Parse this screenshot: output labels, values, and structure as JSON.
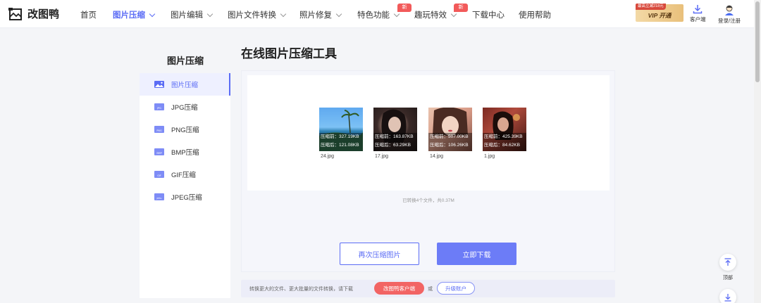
{
  "header": {
    "logo_text": "改图鸭",
    "nav": [
      {
        "label": "首页"
      },
      {
        "label": "图片压缩"
      },
      {
        "label": "图片编辑"
      },
      {
        "label": "图片文件转换"
      },
      {
        "label": "照片修复"
      },
      {
        "label": "特色功能",
        "badge": "新"
      },
      {
        "label": "趣玩特效",
        "badge": "新"
      },
      {
        "label": "下载中心"
      },
      {
        "label": "使用帮助"
      }
    ],
    "vip_tag": "最高立减218元",
    "vip_label": "VIP 开通",
    "client_label": "客户端",
    "login_label": "登录/注册"
  },
  "sidebar": {
    "title": "图片压缩",
    "items": [
      {
        "label": "图片压缩"
      },
      {
        "label": "JPG压缩",
        "icon_text": "JPG"
      },
      {
        "label": "PNG压缩",
        "icon_text": "PNG"
      },
      {
        "label": "BMP压缩",
        "icon_text": "BMP"
      },
      {
        "label": "GIF压缩",
        "icon_text": "GIF"
      },
      {
        "label": "JPEG压缩",
        "icon_text": "JPEG"
      }
    ]
  },
  "main": {
    "title": "在线图片压缩工具",
    "files": [
      {
        "name": "24.jpg",
        "before": "压缩前：327.19KB",
        "after": "压缩后：121.08KB"
      },
      {
        "name": "17.jpg",
        "before": "压缩前：163.87KB",
        "after": "压缩后：63.29KB"
      },
      {
        "name": "14.jpg",
        "before": "压缩前：507.00KB",
        "after": "压缩后：106.26KB"
      },
      {
        "name": "1.jpg",
        "before": "压缩前：425.39KB",
        "after": "压缩后：84.62KB"
      }
    ],
    "summary": "已转换4个文件，共0.37M",
    "recompress_label": "再次压缩图片",
    "download_label": "立即下载"
  },
  "tip": {
    "text": "转换更大的文件、更大批量的文件转换，请下载",
    "client_button": "改图鸭客户端",
    "or": "或",
    "upgrade_button": "升级账户"
  },
  "float": {
    "top_label": "顶部"
  },
  "colors": {
    "accent": "#5b6cf5",
    "primary_button": "#6c7cf7",
    "badge_red": "#f25a5a"
  }
}
